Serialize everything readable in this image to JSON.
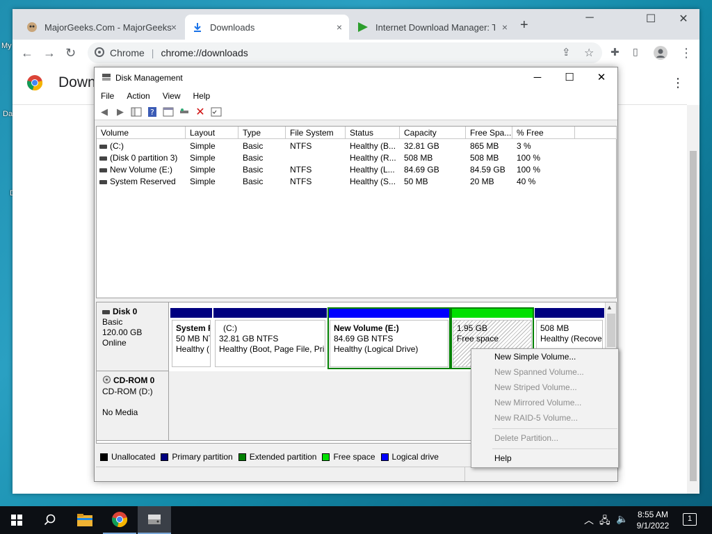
{
  "desktop": {
    "icon1": "My",
    "icon2": "Da",
    "icon3": "D"
  },
  "chrome": {
    "tabs": [
      {
        "title": "MajorGeeks.Com - MajorGeeks",
        "close": "×"
      },
      {
        "title": "Downloads",
        "close": "×"
      },
      {
        "title": "Internet Download Manager: Th",
        "close": "×"
      }
    ],
    "new_tab": "+",
    "window_controls": {
      "min": "─",
      "max": "☐",
      "close": "✕"
    },
    "omnibox": {
      "label": "Chrome",
      "url": "chrome://downloads"
    },
    "page_title": "Downl"
  },
  "disk_management": {
    "title": "Disk Management",
    "window_controls": {
      "min": "─",
      "max": "☐",
      "close": "✕"
    },
    "menu": [
      "File",
      "Action",
      "View",
      "Help"
    ],
    "columns": [
      "Volume",
      "Layout",
      "Type",
      "File System",
      "Status",
      "Capacity",
      "Free Spa...",
      "% Free"
    ],
    "rows": [
      [
        "(C:)",
        "Simple",
        "Basic",
        "NTFS",
        "Healthy (B...",
        "32.81 GB",
        "865 MB",
        "3 %"
      ],
      [
        "(Disk 0 partition 3)",
        "Simple",
        "Basic",
        "",
        "Healthy (R...",
        "508 MB",
        "508 MB",
        "100 %"
      ],
      [
        "New Volume (E:)",
        "Simple",
        "Basic",
        "NTFS",
        "Healthy (L...",
        "84.69 GB",
        "84.59 GB",
        "100 %"
      ],
      [
        "System Reserved",
        "Simple",
        "Basic",
        "NTFS",
        "Healthy (S...",
        "50 MB",
        "20 MB",
        "40 %"
      ]
    ],
    "disk0": {
      "name": "Disk 0",
      "type": "Basic",
      "size": "120.00 GB",
      "status": "Online",
      "partitions": [
        {
          "l1": "System R",
          "l2": "50 MB NT",
          "l3": "Healthy (",
          "color": "#000080"
        },
        {
          "l1": "(C:)",
          "l2": "32.81 GB NTFS",
          "l3": "Healthy (Boot, Page File, Prin",
          "color": "#000080"
        },
        {
          "l1": "New Volume  (E:)",
          "l2": "84.69 GB NTFS",
          "l3": "Healthy (Logical Drive)",
          "color": "#0000ff"
        },
        {
          "l1": "1.95 GB",
          "l2": "Free space",
          "l3": "",
          "color": "#00e000"
        },
        {
          "l1": "508 MB",
          "l2": "Healthy (Recove",
          "l3": "",
          "color": "#000080"
        }
      ]
    },
    "cdrom": {
      "name": "CD-ROM 0",
      "drive": "CD-ROM (D:)",
      "media": "No Media"
    },
    "legend": [
      {
        "label": "Unallocated",
        "color": "#000000"
      },
      {
        "label": "Primary partition",
        "color": "#000080"
      },
      {
        "label": "Extended partition",
        "color": "#008000"
      },
      {
        "label": "Free space",
        "color": "#00e000"
      },
      {
        "label": "Logical drive",
        "color": "#0000ff"
      }
    ]
  },
  "context_menu": {
    "items": [
      {
        "label": "New Simple Volume...",
        "enabled": true
      },
      {
        "label": "New Spanned Volume...",
        "enabled": false
      },
      {
        "label": "New Striped Volume...",
        "enabled": false
      },
      {
        "label": "New Mirrored Volume...",
        "enabled": false
      },
      {
        "label": "New RAID-5 Volume...",
        "enabled": false
      },
      {
        "label": "Delete Partition...",
        "enabled": false
      },
      {
        "label": "Help",
        "enabled": true
      }
    ]
  },
  "taskbar": {
    "time": "8:55 AM",
    "date": "9/1/2022",
    "notifications": "1"
  },
  "colors": {
    "accent": "#1a73e8",
    "taskbar": "#0c0f14"
  }
}
